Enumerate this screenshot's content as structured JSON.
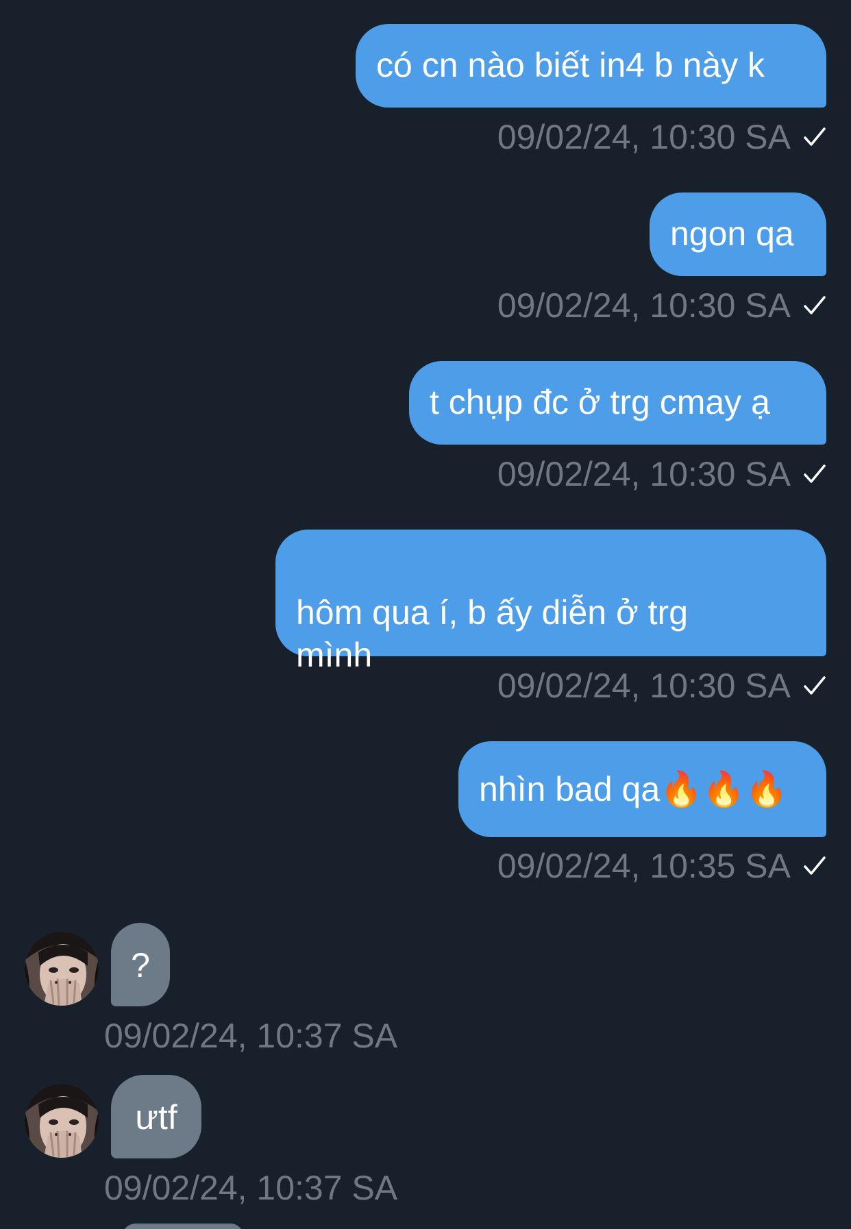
{
  "messages": [
    {
      "text": "có cn nào biết in4 b này k",
      "time": "09/02/24, 10:30 SA"
    },
    {
      "text": "ngon qa",
      "time": "09/02/24, 10:30 SA"
    },
    {
      "text": "t chụp đc ở trg cmay ạ",
      "time": "09/02/24, 10:30 SA"
    },
    {
      "text": "hôm qua í, b ấy diễn ở trg\nmình",
      "time": "09/02/24, 10:30 SA"
    },
    {
      "text": "nhìn bad qa🔥🔥🔥",
      "time": "09/02/24, 10:35 SA"
    },
    {
      "text": "?",
      "time": "09/02/24, 10:37 SA"
    },
    {
      "text": "ưtf",
      "time": "09/02/24, 10:37 SA"
    }
  ],
  "colors": {
    "background": "#18202b",
    "outgoing_bubble": "#4d9de8",
    "incoming_bubble": "#6d7a88",
    "timestamp": "#6f7884"
  },
  "icons": {
    "sent_status": "checkmark-icon",
    "sender_avatar": "avatar"
  }
}
